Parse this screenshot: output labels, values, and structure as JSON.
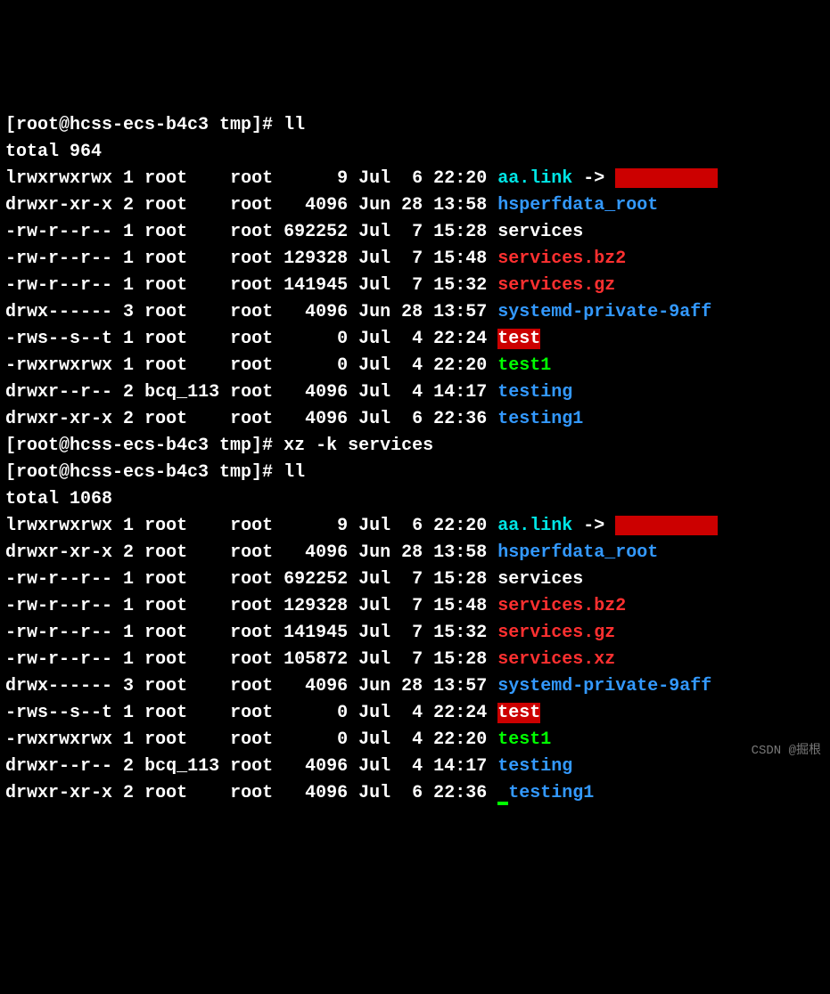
{
  "watermark": "CSDN @掘根",
  "block1": {
    "prompt": "[root@hcss-ecs-b4c3 tmp]# ",
    "cmd": "ll",
    "total": "total 964",
    "rows": [
      {
        "perm": "lrwxrwxrwx",
        "links": "1",
        "owner": "root   ",
        "group": "root",
        "size": "     9",
        "date": "Jul  6 22:20",
        "name": "aa.link",
        "nameClass": "cyan",
        "arrow": " -> ",
        "redacted": true
      },
      {
        "perm": "drwxr-xr-x",
        "links": "2",
        "owner": "root   ",
        "group": "root",
        "size": "  4096",
        "date": "Jun 28 13:58",
        "name": "hsperfdata_root",
        "nameClass": "blue"
      },
      {
        "perm": "-rw-r--r--",
        "links": "1",
        "owner": "root   ",
        "group": "root",
        "size": "692252",
        "date": "Jul  7 15:28",
        "name": "services",
        "nameClass": "white"
      },
      {
        "perm": "-rw-r--r--",
        "links": "1",
        "owner": "root   ",
        "group": "root",
        "size": "129328",
        "date": "Jul  7 15:48",
        "name": "services.bz2",
        "nameClass": "red"
      },
      {
        "perm": "-rw-r--r--",
        "links": "1",
        "owner": "root   ",
        "group": "root",
        "size": "141945",
        "date": "Jul  7 15:32",
        "name": "services.gz",
        "nameClass": "red"
      },
      {
        "perm": "drwx------",
        "links": "3",
        "owner": "root   ",
        "group": "root",
        "size": "  4096",
        "date": "Jun 28 13:57",
        "name": "systemd-private-9aff",
        "nameClass": "blue",
        "cut": true
      },
      {
        "perm": "-rws--s--t",
        "links": "1",
        "owner": "root   ",
        "group": "root",
        "size": "     0",
        "date": "Jul  4 22:24",
        "name": "test",
        "nameClass": "redbg"
      },
      {
        "perm": "-rwxrwxrwx",
        "links": "1",
        "owner": "root   ",
        "group": "root",
        "size": "     0",
        "date": "Jul  4 22:20",
        "name": "test1",
        "nameClass": "green"
      },
      {
        "perm": "drwxr--r--",
        "links": "2",
        "owner": "bcq_113",
        "group": "root",
        "size": "  4096",
        "date": "Jul  4 14:17",
        "name": "testing",
        "nameClass": "blue"
      },
      {
        "perm": "drwxr-xr-x",
        "links": "2",
        "owner": "root   ",
        "group": "root",
        "size": "  4096",
        "date": "Jul  6 22:36",
        "name": "testing1",
        "nameClass": "blue"
      }
    ]
  },
  "middle": {
    "prompt": "[root@hcss-ecs-b4c3 tmp]# ",
    "cmd": "xz -k services"
  },
  "block2": {
    "prompt": "[root@hcss-ecs-b4c3 tmp]# ",
    "cmd": "ll",
    "total": "total 1068",
    "rows": [
      {
        "perm": "lrwxrwxrwx",
        "links": "1",
        "owner": "root   ",
        "group": "root",
        "size": "     9",
        "date": "Jul  6 22:20",
        "name": "aa.link",
        "nameClass": "cyan",
        "arrow": " -> ",
        "redacted": true
      },
      {
        "perm": "drwxr-xr-x",
        "links": "2",
        "owner": "root   ",
        "group": "root",
        "size": "  4096",
        "date": "Jun 28 13:58",
        "name": "hsperfdata_root",
        "nameClass": "blue"
      },
      {
        "perm": "-rw-r--r--",
        "links": "1",
        "owner": "root   ",
        "group": "root",
        "size": "692252",
        "date": "Jul  7 15:28",
        "name": "services",
        "nameClass": "white"
      },
      {
        "perm": "-rw-r--r--",
        "links": "1",
        "owner": "root   ",
        "group": "root",
        "size": "129328",
        "date": "Jul  7 15:48",
        "name": "services.bz2",
        "nameClass": "red"
      },
      {
        "perm": "-rw-r--r--",
        "links": "1",
        "owner": "root   ",
        "group": "root",
        "size": "141945",
        "date": "Jul  7 15:32",
        "name": "services.gz",
        "nameClass": "red"
      },
      {
        "perm": "-rw-r--r--",
        "links": "1",
        "owner": "root   ",
        "group": "root",
        "size": "105872",
        "date": "Jul  7 15:28",
        "name": "services.xz",
        "nameClass": "red"
      },
      {
        "perm": "drwx------",
        "links": "3",
        "owner": "root   ",
        "group": "root",
        "size": "  4096",
        "date": "Jun 28 13:57",
        "name": "systemd-private-9aff",
        "nameClass": "blue",
        "cut": true
      },
      {
        "perm": "-rws--s--t",
        "links": "1",
        "owner": "root   ",
        "group": "root",
        "size": "     0",
        "date": "Jul  4 22:24",
        "name": "test",
        "nameClass": "redbg"
      },
      {
        "perm": "-rwxrwxrwx",
        "links": "1",
        "owner": "root   ",
        "group": "root",
        "size": "     0",
        "date": "Jul  4 22:20",
        "name": "test1",
        "nameClass": "green"
      },
      {
        "perm": "drwxr--r--",
        "links": "2",
        "owner": "bcq_113",
        "group": "root",
        "size": "  4096",
        "date": "Jul  4 14:17",
        "name": "testing",
        "nameClass": "blue"
      },
      {
        "perm": "drwxr-xr-x",
        "links": "2",
        "owner": "root   ",
        "group": "root",
        "size": "  4096",
        "date": "Jul  6 22:36",
        "name": "testing1",
        "nameClass": "blue",
        "last": true
      }
    ]
  }
}
